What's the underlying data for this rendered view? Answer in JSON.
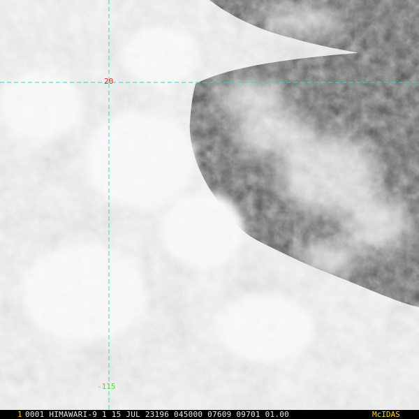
{
  "colors": {
    "graticule": "#35d6d6",
    "lat_label": "#ff2020",
    "lon_label": "#40e040",
    "frame_number": "#ffd21e",
    "header_text": "#e8e8e8",
    "brand": "#ffd21e",
    "status_bar_bg": "#000000"
  },
  "graticule": {
    "latitude_label": "20",
    "longitude_label": "-115"
  },
  "status_bar": {
    "frame_number": "1",
    "header": "0001 HIMAWARI-9   1 15 JUL 23196 045000 07609 09701 01.00",
    "brand": "McIDAS"
  },
  "icons": {
    "imagery": "satellite-visible-cloud-imagery"
  }
}
